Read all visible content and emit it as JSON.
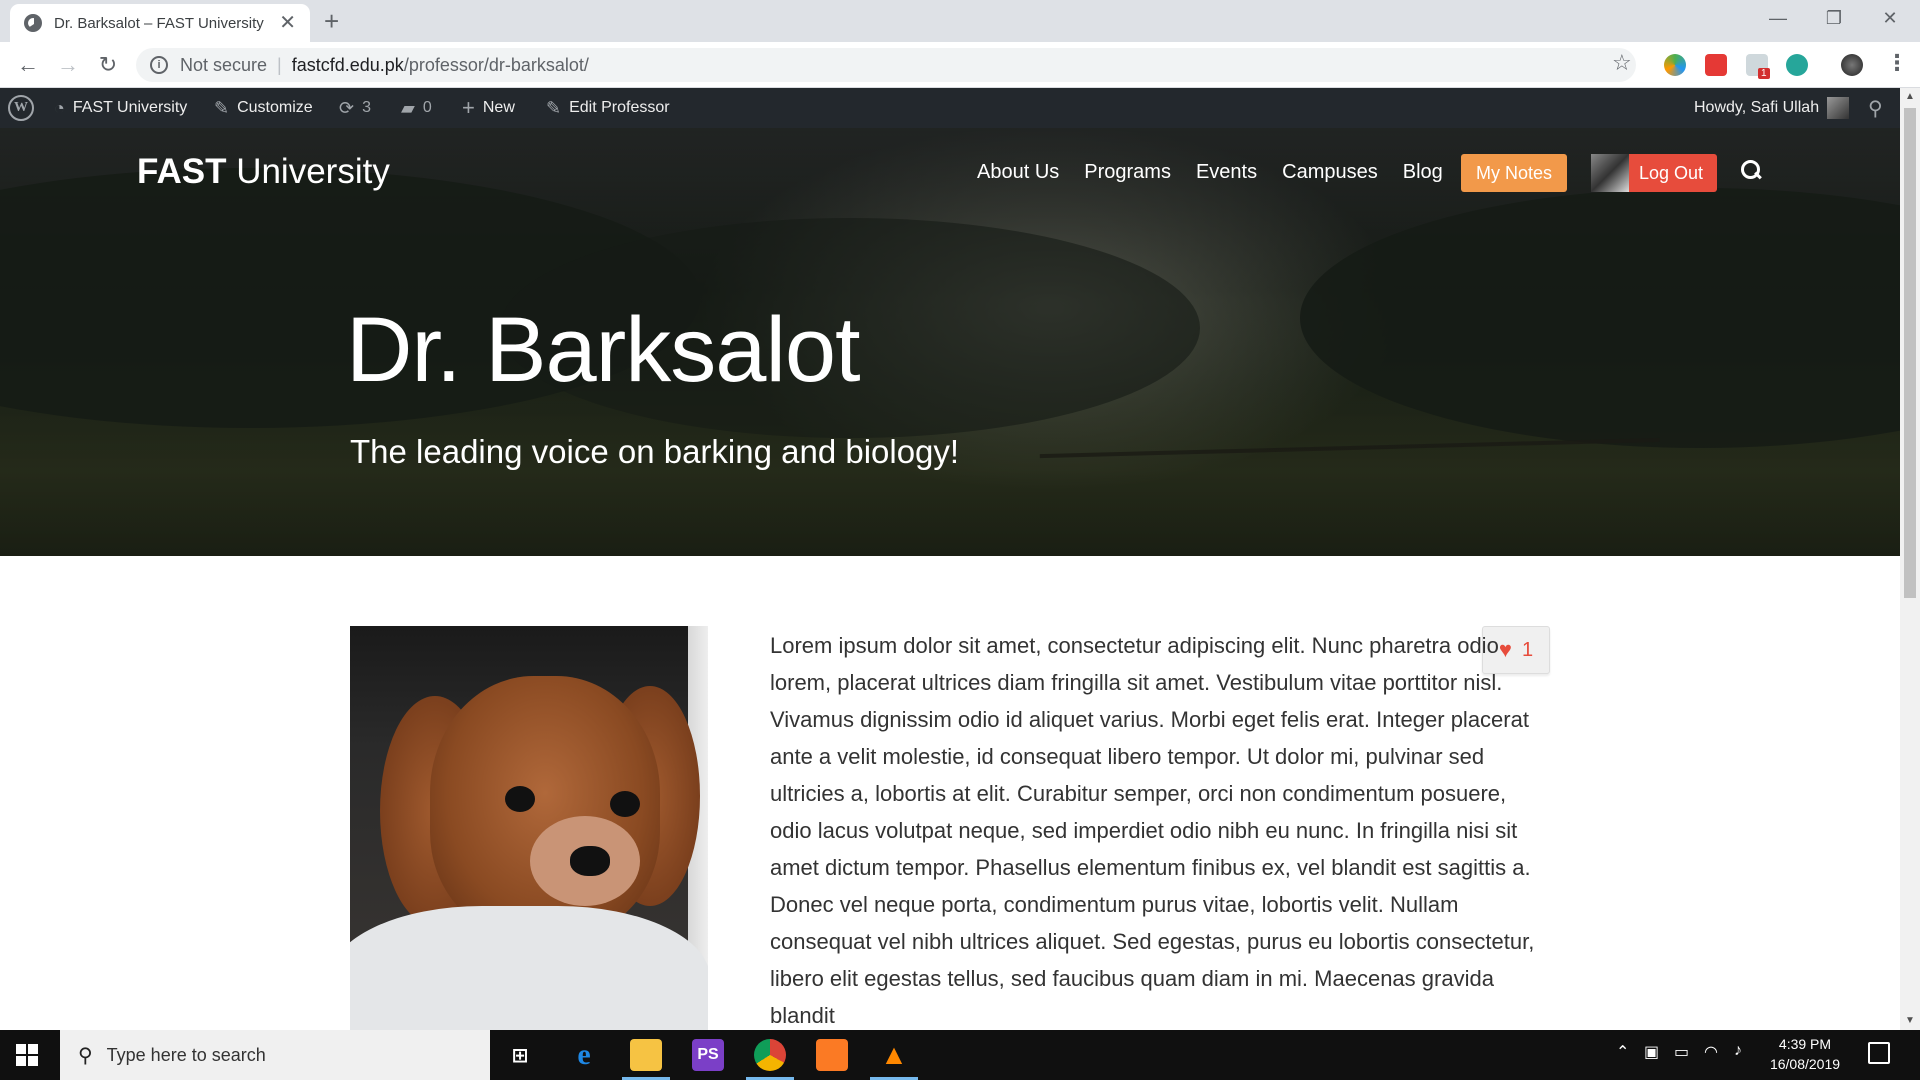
{
  "browser": {
    "tab_title": "Dr. Barksalot – FAST University",
    "tab_close": "✕",
    "new_tab": "+",
    "url_security": "Not secure",
    "url_separator": "|",
    "url_host": "fastcfd.edu.pk",
    "url_path": "/professor/dr-barksalot/",
    "back": "←",
    "forward": "→",
    "reload": "↻",
    "bookmark": "☆",
    "minimize": "—",
    "maximize": "❐",
    "close": "✕",
    "menu": "⋮",
    "ext_badge": "1"
  },
  "adminbar": {
    "site_name": "FAST University",
    "customize": "Customize",
    "updates_count": "3",
    "comments_count": "0",
    "new_label": "New",
    "edit_label": "Edit Professor",
    "howdy": "Howdy, Safi Ullah"
  },
  "header": {
    "logo_bold": "FAST",
    "logo_light": "University",
    "nav": [
      "About Us",
      "Programs",
      "Events",
      "Campuses",
      "Blog"
    ],
    "my_notes": "My Notes",
    "log_out": "Log Out"
  },
  "hero": {
    "title": "Dr. Barksalot",
    "subtitle": "The leading voice on barking and biology!"
  },
  "content": {
    "like_count": "1",
    "body": "Lorem ipsum dolor sit amet, consectetur adipiscing elit. Nunc pharetra odio lorem, placerat ultrices diam fringilla sit amet. Vestibulum vitae porttitor nisl. Vivamus dignissim odio id aliquet varius. Morbi eget felis erat. Integer placerat ante a velit molestie, id consequat libero tempor. Ut dolor mi, pulvinar sed ultricies a, lobortis at elit. Curabitur semper, orci non condimentum posuere, odio lacus volutpat neque, sed imperdiet odio nibh eu nunc. In fringilla nisi sit amet dictum tempor. Phasellus elementum finibus ex, vel blandit est sagittis a. Donec vel neque porta, condimentum purus vitae, lobortis velit. Nullam consequat vel nibh ultrices aliquet. Sed egestas, purus eu lobortis consectetur, libero elit egestas tellus, sed faucibus quam diam in mi. Maecenas gravida blandit"
  },
  "taskbar": {
    "search_placeholder": "Type here to search",
    "time": "4:39 PM",
    "date": "16/08/2019",
    "ps_label": "PS"
  },
  "colors": {
    "accent_orange": "#f2994a",
    "accent_red": "#e74c3c",
    "adminbar": "#23282d"
  }
}
